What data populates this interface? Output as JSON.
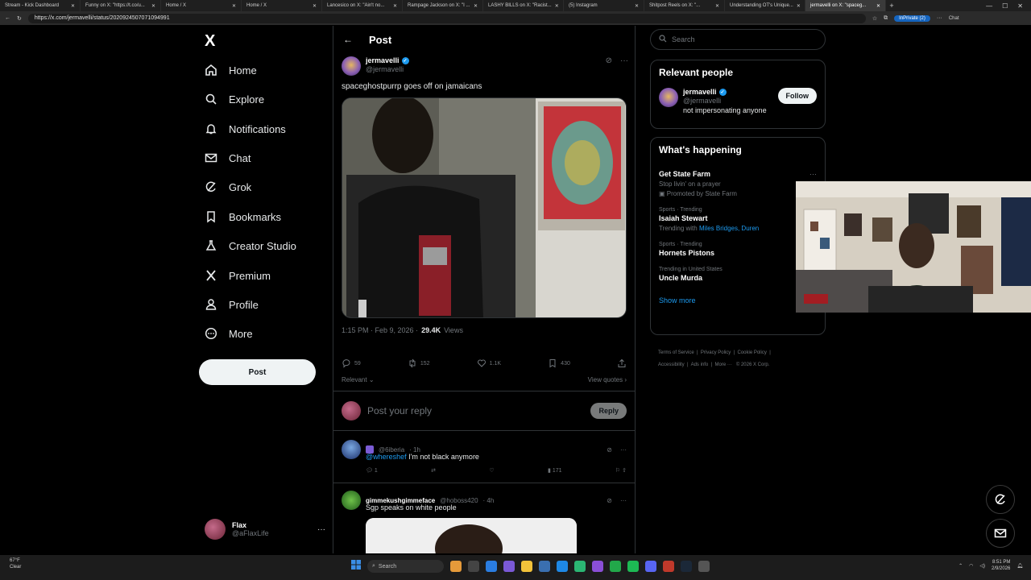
{
  "browser": {
    "tabs": [
      {
        "label": "Stream - Kick Dashboard"
      },
      {
        "label": "Funny on X: \"https://t.co/u..."
      },
      {
        "label": "Home / X"
      },
      {
        "label": "Home / X"
      },
      {
        "label": "Lancesico on X: \"Ain't no..."
      },
      {
        "label": "Rampage Jackson on X: \"I ..."
      },
      {
        "label": "LASHY BILLS on X: \"Racist..."
      },
      {
        "label": "(5) Instagram"
      },
      {
        "label": "Shitpost Reels on X: \"..."
      },
      {
        "label": "Understanding OT's Unique..."
      },
      {
        "label": "jermavelli on X: \"spaceg..."
      }
    ],
    "url": "https://x.com/jermavelli/status/2020924507071094991",
    "inprivate_label": "InPrivate (2)",
    "chat_label": "Chat"
  },
  "nav": {
    "logo": "X",
    "items": [
      {
        "label": "Home",
        "icon": "home-icon"
      },
      {
        "label": "Explore",
        "icon": "search-icon"
      },
      {
        "label": "Notifications",
        "icon": "bell-icon"
      },
      {
        "label": "Chat",
        "icon": "mail-icon"
      },
      {
        "label": "Grok",
        "icon": "grok-icon"
      },
      {
        "label": "Bookmarks",
        "icon": "bookmark-icon"
      },
      {
        "label": "Creator Studio",
        "icon": "flask-icon"
      },
      {
        "label": "Premium",
        "icon": "x-icon"
      },
      {
        "label": "Profile",
        "icon": "person-icon"
      },
      {
        "label": "More",
        "icon": "more-circle-icon"
      }
    ],
    "post_button": "Post",
    "account": {
      "name": "Flax",
      "handle": "@aFlaxLife",
      "more": "···"
    }
  },
  "main": {
    "back": "←",
    "title": "Post",
    "post": {
      "name": "jermavelli",
      "handle": "@jermavelli",
      "text": "spaceghostpurrp goes off on jamaicans",
      "time": "1:15 PM · Feb 9, 2026 ·",
      "views_count": "29.4K",
      "views_label": "Views",
      "replies": "59",
      "reposts": "152",
      "likes": "1.1K",
      "bookmarks": "430"
    },
    "sort_label": "Relevant",
    "view_quotes": "View quotes",
    "reply_placeholder": "Post your reply",
    "reply_button": "Reply",
    "replies": [
      {
        "name": "",
        "handle": "@6iberia",
        "time": "· 1h",
        "mention": "@whereshef",
        "text": "I'm not black anymore",
        "replies": "1",
        "likes": "",
        "views": "171"
      },
      {
        "name": "gimmekushgimmeface",
        "handle": "@hoboss420",
        "time": "· 4h",
        "mention": "",
        "text": "Sgp speaks on white people"
      }
    ]
  },
  "right": {
    "search_placeholder": "Search",
    "relevant_people": {
      "title": "Relevant people",
      "name": "jermavelli",
      "handle": "@jermavelli",
      "bio": "not impersonating anyone",
      "follow": "Follow"
    },
    "whats_happening": {
      "title": "What's happening",
      "trends": [
        {
          "label": "",
          "title": "Get State Farm",
          "sub": "Stop livin' on a prayer",
          "sub2": "Promoted by State Farm",
          "link": ""
        },
        {
          "label": "Sports · Trending",
          "title": "Isaiah Stewart",
          "sub": "Trending with",
          "link": "Miles Bridges, Duren",
          "sub2": ""
        },
        {
          "label": "Sports · Trending",
          "title": "Hornets Pistons",
          "sub": "",
          "link": "",
          "sub2": ""
        },
        {
          "label": "Trending in United States",
          "title": "Uncle Murda",
          "sub": "",
          "link": "",
          "sub2": ""
        }
      ],
      "show_more": "Show more"
    },
    "footer": {
      "line1": [
        "Terms of Service",
        "Privacy Policy",
        "Cookie Policy"
      ],
      "line2": [
        "Accessibility",
        "Ads info",
        "More ···",
        "© 2026 X Corp."
      ]
    }
  },
  "taskbar": {
    "weather_temp": "67°F",
    "weather_desc": "Clear",
    "search": "Search",
    "time": "8:51 PM",
    "date": "2/9/2026"
  },
  "colors": {
    "accent": "#1d9bf0",
    "background": "#000000",
    "muted": "#71767b",
    "border": "#2f3336"
  }
}
